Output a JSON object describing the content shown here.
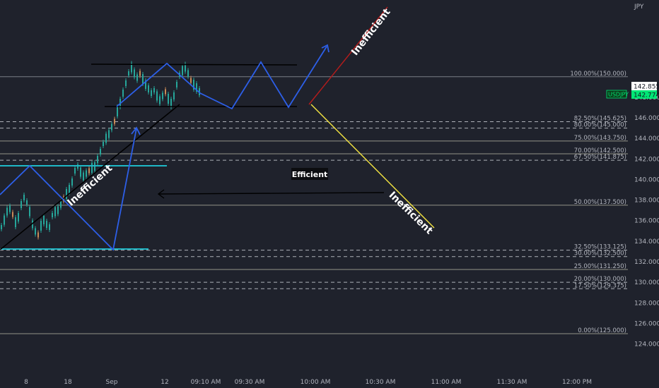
{
  "chart_data": {
    "type": "line",
    "symbol": "USDJPY",
    "currency": "JPY",
    "last_price": "142.855",
    "symbol_price": "142.774",
    "ylim": [
      122.8,
      151.0
    ],
    "y_ticks": [
      "148.000",
      "146.000",
      "144.000",
      "142.000",
      "140.000",
      "138.000",
      "136.000",
      "134.000",
      "132.000",
      "130.000",
      "128.000",
      "126.000",
      "124.000"
    ],
    "x_ticks": [
      "8",
      "18",
      "Sep",
      "12",
      "09:10 AM",
      "09:30 AM",
      "10:00 AM",
      "10:30 AM",
      "11:00 AM",
      "11:30 AM",
      "12:00 PM"
    ],
    "fib_levels": [
      {
        "label": "100.00%(150.000)",
        "price": 150.0,
        "style": "solid",
        "color": "#8a8f98"
      },
      {
        "label": "82.50%(145.625)",
        "price": 145.625,
        "style": "dashed",
        "color": "#c7cad1"
      },
      {
        "label": "80.00%(145.000)",
        "price": 145.0,
        "style": "dashed",
        "color": "#c7cad1"
      },
      {
        "label": "75.00%(143.750)",
        "price": 143.75,
        "style": "solid",
        "color": "#a8a89a"
      },
      {
        "label": "70.00%(142.500)",
        "price": 142.5,
        "style": "solid",
        "color": "#a8a89a"
      },
      {
        "label": "67.50%(141.875)",
        "price": 141.875,
        "style": "dashed",
        "color": "#c7cad1"
      },
      {
        "label": "50.00%(137.500)",
        "price": 137.5,
        "style": "solid",
        "color": "#a8a89a"
      },
      {
        "label": "32.50%(133.125)",
        "price": 133.125,
        "style": "dashed",
        "color": "#c7cad1"
      },
      {
        "label": "30.00%(132.500)",
        "price": 132.5,
        "style": "dashed",
        "color": "#c7cad1"
      },
      {
        "label": "25.00%(131.250)",
        "price": 131.25,
        "style": "solid",
        "color": "#a8a89a"
      },
      {
        "label": "20.00%(130.000)",
        "price": 130.0,
        "style": "dashed",
        "color": "#c7cad1"
      },
      {
        "label": "17.50%(129.375)",
        "price": 129.375,
        "style": "dashed",
        "color": "#c7cad1"
      },
      {
        "label": "0.00%(125.000)",
        "price": 125.0,
        "style": "solid",
        "color": "#a8a89a"
      }
    ],
    "annotations": {
      "efficient": "Efficient",
      "inefficient": "Inefficient"
    },
    "colors": {
      "background": "#1f222c",
      "up_candle": "#26a69a",
      "blue_path": "#2962ff",
      "cyan_level": "#00bcd4",
      "yellow_line": "#f5e642",
      "red_line": "#c62828",
      "price_tag": "#ffffff",
      "symbol_tag": "#00e676"
    }
  }
}
